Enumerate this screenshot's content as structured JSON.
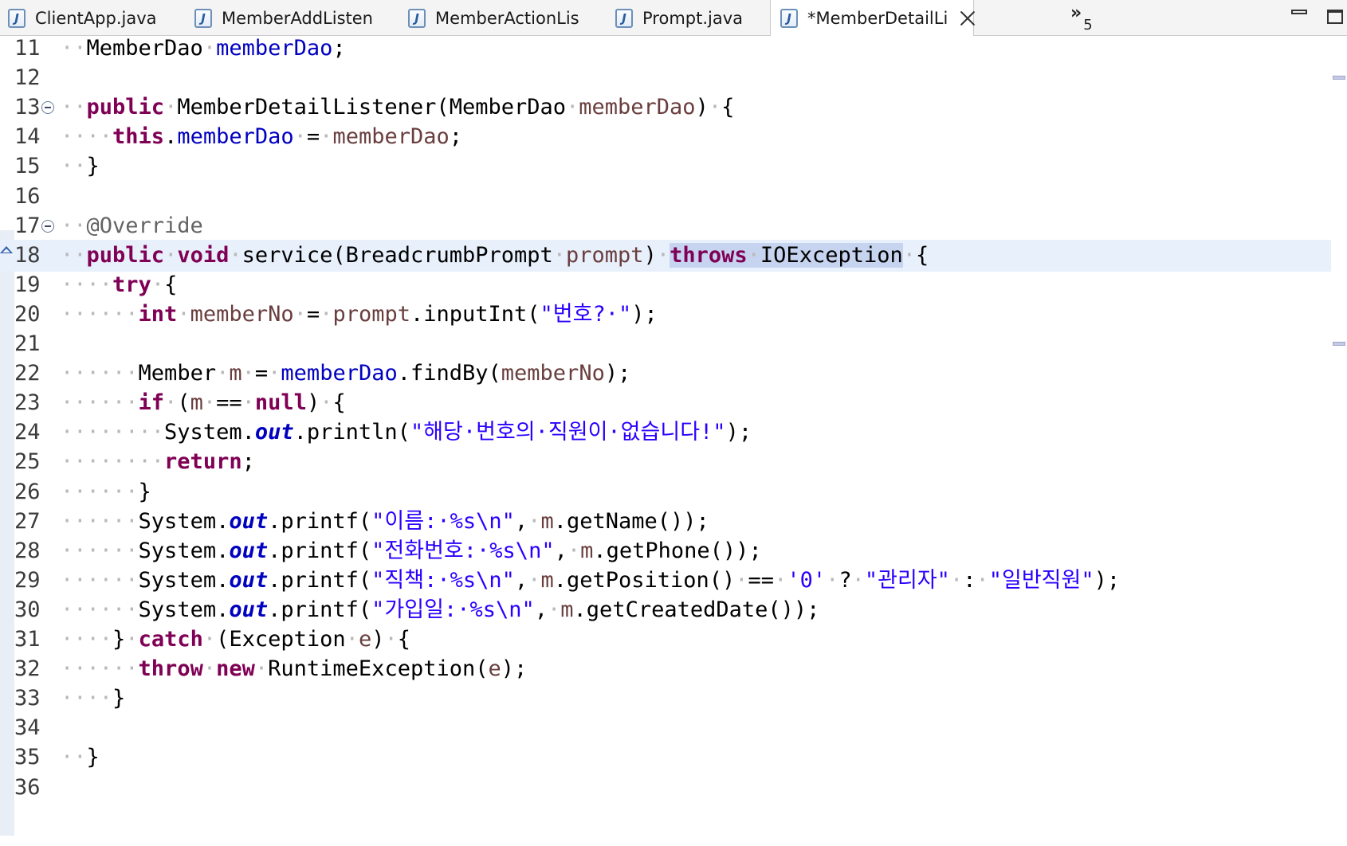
{
  "tabs": [
    {
      "label": "ClientApp.java",
      "active": false
    },
    {
      "label": "MemberAddListen",
      "active": false
    },
    {
      "label": "MemberActionLis",
      "active": false
    },
    {
      "label": "Prompt.java",
      "active": false
    },
    {
      "label": "*MemberDetailLi",
      "active": true
    }
  ],
  "overflow": {
    "glyph": "»",
    "count": "5"
  },
  "icons": {
    "java_file": "J",
    "tab_close": "close-icon",
    "minimize": "minimize-icon",
    "maximize": "maximize-icon"
  },
  "editor": {
    "current_line": 18,
    "lines": [
      {
        "no": "11",
        "tokens": [
          [
            "ws",
            "··"
          ],
          [
            "",
            "MemberDao"
          ],
          [
            "ws",
            "·"
          ],
          [
            "fld",
            "memberDao"
          ],
          [
            "",
            ";"
          ]
        ]
      },
      {
        "no": "12",
        "tokens": []
      },
      {
        "no": "13",
        "fold": true,
        "tokens": [
          [
            "ws",
            "··"
          ],
          [
            "kw",
            "public"
          ],
          [
            "ws",
            "·"
          ],
          [
            "",
            "MemberDetailListener(MemberDao"
          ],
          [
            "ws",
            "·"
          ],
          [
            "par",
            "memberDao"
          ],
          [
            "",
            ")"
          ],
          [
            "ws",
            "·"
          ],
          [
            "",
            "{"
          ]
        ]
      },
      {
        "no": "14",
        "tokens": [
          [
            "ws",
            "····"
          ],
          [
            "kw",
            "this"
          ],
          [
            "",
            "."
          ],
          [
            "fld",
            "memberDao"
          ],
          [
            "ws",
            "·"
          ],
          [
            "",
            "="
          ],
          [
            "ws",
            "·"
          ],
          [
            "par",
            "memberDao"
          ],
          [
            "",
            ";"
          ]
        ]
      },
      {
        "no": "15",
        "tokens": [
          [
            "ws",
            "··"
          ],
          [
            "",
            "}"
          ]
        ]
      },
      {
        "no": "16",
        "tokens": []
      },
      {
        "no": "17",
        "fold": true,
        "tokens": [
          [
            "ws",
            "··"
          ],
          [
            "ann",
            "@Override"
          ]
        ]
      },
      {
        "no": "18",
        "override": true,
        "current": true,
        "tokens": [
          [
            "ws",
            "··"
          ],
          [
            "kw",
            "public"
          ],
          [
            "ws",
            "·"
          ],
          [
            "kw",
            "void"
          ],
          [
            "ws",
            "·"
          ],
          [
            "",
            "service(BreadcrumbPrompt"
          ],
          [
            "ws",
            "·"
          ],
          [
            "par",
            "prompt"
          ],
          [
            "",
            ")"
          ],
          [
            "ws",
            "·"
          ],
          [
            "kw hl",
            "throws"
          ],
          [
            "ws hl",
            "·"
          ],
          [
            "hl",
            "IOException"
          ],
          [
            "ws",
            "·"
          ],
          [
            "",
            "{"
          ]
        ]
      },
      {
        "no": "19",
        "tokens": [
          [
            "ws",
            "····"
          ],
          [
            "kw",
            "try"
          ],
          [
            "ws",
            "·"
          ],
          [
            "",
            "{"
          ]
        ]
      },
      {
        "no": "20",
        "tokens": [
          [
            "ws",
            "······"
          ],
          [
            "kw",
            "int"
          ],
          [
            "ws",
            "·"
          ],
          [
            "par",
            "memberNo"
          ],
          [
            "ws",
            "·"
          ],
          [
            "",
            "="
          ],
          [
            "ws",
            "·"
          ],
          [
            "par",
            "prompt"
          ],
          [
            "",
            ".inputInt("
          ],
          [
            "str",
            "\"번호?·\""
          ],
          [
            "",
            ");"
          ]
        ]
      },
      {
        "no": "21",
        "tokens": []
      },
      {
        "no": "22",
        "tokens": [
          [
            "ws",
            "······"
          ],
          [
            "",
            "Member"
          ],
          [
            "ws",
            "·"
          ],
          [
            "par",
            "m"
          ],
          [
            "ws",
            "·"
          ],
          [
            "",
            "="
          ],
          [
            "ws",
            "·"
          ],
          [
            "fld",
            "memberDao"
          ],
          [
            "",
            ".findBy("
          ],
          [
            "par",
            "memberNo"
          ],
          [
            "",
            ");"
          ]
        ]
      },
      {
        "no": "23",
        "tokens": [
          [
            "ws",
            "······"
          ],
          [
            "kw",
            "if"
          ],
          [
            "ws",
            "·"
          ],
          [
            "",
            "("
          ],
          [
            "par",
            "m"
          ],
          [
            "ws",
            "·"
          ],
          [
            "",
            "=="
          ],
          [
            "ws",
            "·"
          ],
          [
            "kw",
            "null"
          ],
          [
            "",
            ")"
          ],
          [
            "ws",
            "·"
          ],
          [
            "",
            "{"
          ]
        ]
      },
      {
        "no": "24",
        "tokens": [
          [
            "ws",
            "········"
          ],
          [
            "",
            "System."
          ],
          [
            "sfld",
            "out"
          ],
          [
            "",
            ".println("
          ],
          [
            "str",
            "\"해당·번호의·직원이·없습니다!\""
          ],
          [
            "",
            ");"
          ]
        ]
      },
      {
        "no": "25",
        "tokens": [
          [
            "ws",
            "········"
          ],
          [
            "kw",
            "return"
          ],
          [
            "",
            ";"
          ]
        ]
      },
      {
        "no": "26",
        "tokens": [
          [
            "ws",
            "······"
          ],
          [
            "",
            "}"
          ]
        ]
      },
      {
        "no": "27",
        "tokens": [
          [
            "ws",
            "······"
          ],
          [
            "",
            "System."
          ],
          [
            "sfld",
            "out"
          ],
          [
            "",
            ".printf("
          ],
          [
            "str",
            "\"이름:·%s\\n\""
          ],
          [
            "",
            ","
          ],
          [
            "ws",
            "·"
          ],
          [
            "par",
            "m"
          ],
          [
            "",
            ".getName());"
          ]
        ]
      },
      {
        "no": "28",
        "tokens": [
          [
            "ws",
            "······"
          ],
          [
            "",
            "System."
          ],
          [
            "sfld",
            "out"
          ],
          [
            "",
            ".printf("
          ],
          [
            "str",
            "\"전화번호:·%s\\n\""
          ],
          [
            "",
            ","
          ],
          [
            "ws",
            "·"
          ],
          [
            "par",
            "m"
          ],
          [
            "",
            ".getPhone());"
          ]
        ]
      },
      {
        "no": "29",
        "tokens": [
          [
            "ws",
            "······"
          ],
          [
            "",
            "System."
          ],
          [
            "sfld",
            "out"
          ],
          [
            "",
            ".printf("
          ],
          [
            "str",
            "\"직책:·%s\\n\""
          ],
          [
            "",
            ","
          ],
          [
            "ws",
            "·"
          ],
          [
            "par",
            "m"
          ],
          [
            "",
            ".getPosition()"
          ],
          [
            "ws",
            "·"
          ],
          [
            "",
            "=="
          ],
          [
            "ws",
            "·"
          ],
          [
            "str",
            "'0'"
          ],
          [
            "ws",
            "·"
          ],
          [
            "",
            "?"
          ],
          [
            "ws",
            "·"
          ],
          [
            "str",
            "\"관리자\""
          ],
          [
            "ws",
            "·"
          ],
          [
            "",
            ":"
          ],
          [
            "ws",
            "·"
          ],
          [
            "str",
            "\"일반직원\""
          ],
          [
            "",
            ");"
          ]
        ]
      },
      {
        "no": "30",
        "tokens": [
          [
            "ws",
            "······"
          ],
          [
            "",
            "System."
          ],
          [
            "sfld",
            "out"
          ],
          [
            "",
            ".printf("
          ],
          [
            "str",
            "\"가입일:·%s\\n\""
          ],
          [
            "",
            ","
          ],
          [
            "ws",
            "·"
          ],
          [
            "par",
            "m"
          ],
          [
            "",
            ".getCreatedDate());"
          ]
        ]
      },
      {
        "no": "31",
        "tokens": [
          [
            "ws",
            "····"
          ],
          [
            "",
            "}"
          ],
          [
            "ws",
            "·"
          ],
          [
            "kw",
            "catch"
          ],
          [
            "ws",
            "·"
          ],
          [
            "",
            "(Exception"
          ],
          [
            "ws",
            "·"
          ],
          [
            "par",
            "e"
          ],
          [
            "",
            ")"
          ],
          [
            "ws",
            "·"
          ],
          [
            "",
            "{"
          ]
        ]
      },
      {
        "no": "32",
        "tokens": [
          [
            "ws",
            "······"
          ],
          [
            "kw",
            "throw"
          ],
          [
            "ws",
            "·"
          ],
          [
            "kw",
            "new"
          ],
          [
            "ws",
            "·"
          ],
          [
            "",
            "RuntimeException("
          ],
          [
            "par",
            "e"
          ],
          [
            "",
            ");"
          ]
        ]
      },
      {
        "no": "33",
        "tokens": [
          [
            "ws",
            "····"
          ],
          [
            "",
            "}"
          ]
        ]
      },
      {
        "no": "34",
        "tokens": []
      },
      {
        "no": "35",
        "tokens": [
          [
            "ws",
            "··"
          ],
          [
            "",
            "}"
          ]
        ]
      },
      {
        "no": "36",
        "tokens": []
      }
    ]
  }
}
